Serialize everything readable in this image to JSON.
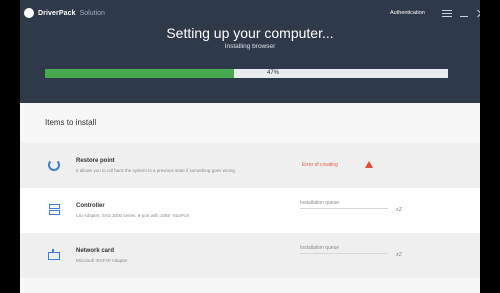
{
  "app": {
    "name": "DriverPack",
    "name_suffix": "Solution",
    "auth_label": "Authentication",
    "title": "Setting up your computer...",
    "subtitle": "Installing browser"
  },
  "progress": {
    "percent_label": "47%",
    "value": 0.47
  },
  "section": {
    "title": "Items to install"
  },
  "items": [
    {
      "name": "Restore point",
      "description": "It allows you to roll back the system to a previous state if something goes wrong",
      "status": "Error of creating",
      "icon": "restore-icon"
    },
    {
      "name": "Controller",
      "description": "LSI Adapter, SAS 3000 series, 8-port with 1068 -StorPort",
      "status": "Installation queue",
      "icon": "controller-icon"
    },
    {
      "name": "Network card",
      "description": "Microsoft ISATAP Adapter",
      "status": "Installation queue",
      "icon": "network-icon"
    }
  ],
  "icons": {
    "queue_glyph": "zZ"
  }
}
